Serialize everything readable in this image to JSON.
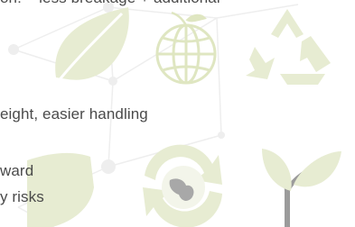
{
  "text_lines": [
    "on: – less breakage + additional",
    "eight, easier handling",
    "ward",
    "y risks"
  ],
  "colors": {
    "text": "#4a4a4a",
    "icon_fill": "#e7ecd2",
    "icon_stroke": "#d3dbb0",
    "network": "#eeeeee",
    "stem": "#9b9b9b"
  },
  "icons": [
    "leaf-icon",
    "globe-icon",
    "recycle-icon",
    "shield-icon",
    "recycling-globe-icon",
    "sprout-icon"
  ]
}
